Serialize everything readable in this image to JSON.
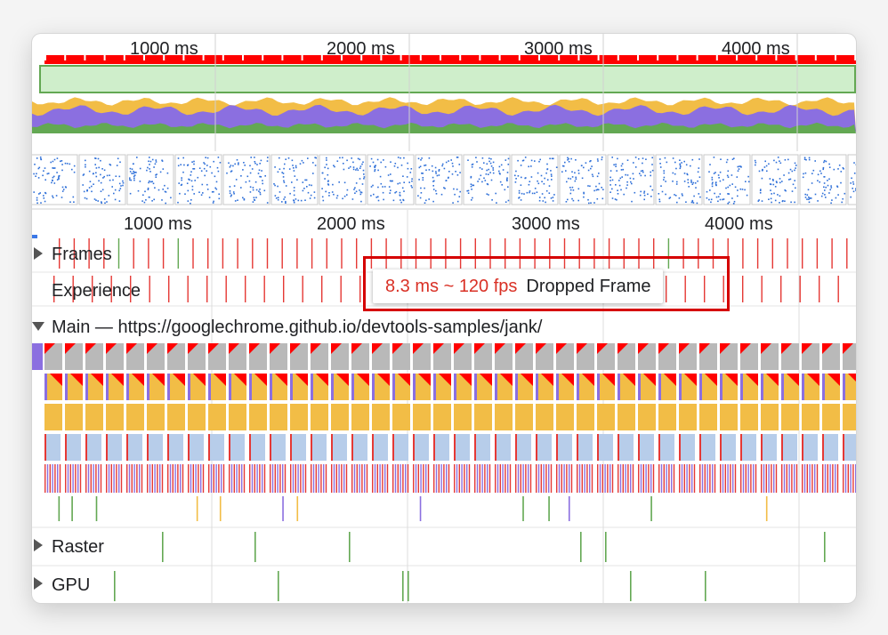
{
  "overview": {
    "ruler_ticks": [
      "1000 ms",
      "2000 ms",
      "3000 ms",
      "4000 ms"
    ]
  },
  "main_ruler": {
    "ticks": [
      "1000 ms",
      "2000 ms",
      "3000 ms",
      "4000 ms"
    ]
  },
  "tracks": {
    "frames": "Frames",
    "experience": "Experience",
    "main": "Main — https://googlechrome.github.io/devtools-samples/jank/",
    "raster": "Raster",
    "gpu": "GPU"
  },
  "tooltip": {
    "fps": "8.3 ms ~ 120 fps",
    "description": "Dropped Frame"
  },
  "colors": {
    "dropped_frame": "#e53935",
    "idle_frame": "#e8e8e8",
    "network_bar": "#cfeecb",
    "scripting": "#f2bd46",
    "rendering": "#8b6fe0",
    "painting": "#63a853",
    "layout_blue": "#b7cdea",
    "task_gray": "#b9b9b9",
    "long_task_red": "#ff0000",
    "highlight_border": "#d50000"
  },
  "icons": {
    "frames_toggle": "triangle-right-icon",
    "main_toggle": "triangle-down-icon",
    "raster_toggle": "triangle-right-icon",
    "gpu_toggle": "triangle-right-icon"
  }
}
